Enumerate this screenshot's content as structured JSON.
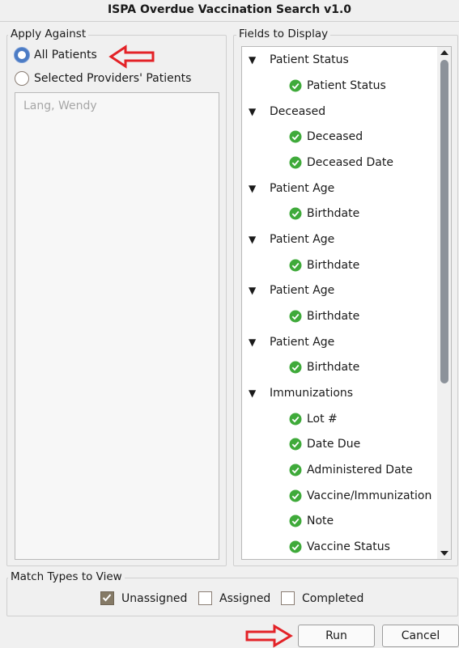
{
  "window": {
    "title": "ISPA Overdue Vaccination Search v1.0"
  },
  "apply_against": {
    "label": "Apply Against",
    "options": [
      "All Patients",
      "Selected Providers' Patients"
    ],
    "providers": [
      "Lang, Wendy"
    ]
  },
  "fields": {
    "label": "Fields to Display",
    "tree": [
      {
        "group": "Patient Status",
        "children": [
          "Patient Status"
        ]
      },
      {
        "group": "Deceased",
        "children": [
          "Deceased",
          "Deceased Date"
        ]
      },
      {
        "group": "Patient Age",
        "children": [
          "Birthdate"
        ]
      },
      {
        "group": "Patient Age",
        "children": [
          "Birthdate"
        ]
      },
      {
        "group": "Patient Age",
        "children": [
          "Birthdate"
        ]
      },
      {
        "group": "Patient Age",
        "children": [
          "Birthdate"
        ]
      },
      {
        "group": "Immunizations",
        "children": [
          "Lot #",
          "Date Due",
          "Administered Date",
          "Vaccine/Immunization",
          "Note",
          "Vaccine Status"
        ]
      }
    ]
  },
  "match_types": {
    "label": "Match Types to View",
    "options": [
      "Unassigned",
      "Assigned",
      "Completed"
    ]
  },
  "buttons": {
    "run": "Run",
    "cancel": "Cancel"
  },
  "colors": {
    "accent": "#4b7bc4",
    "annotation_arrow": "#e32227",
    "check_green": "#3faa3a"
  },
  "icons": {
    "field_check": "check-circle-icon",
    "expand": "triangle-down-icon"
  }
}
